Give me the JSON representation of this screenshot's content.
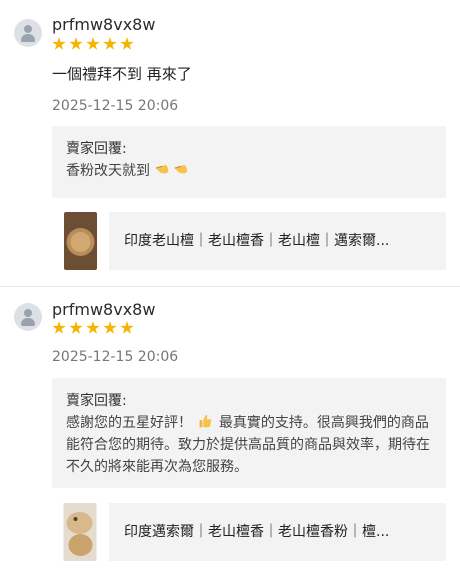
{
  "reviews": [
    {
      "username": "prfmw8vx8w",
      "rating": 5,
      "comment": "一個禮拜不到 再來了",
      "date": "2025-12-15 20:06",
      "reply_title": "賣家回覆:",
      "reply_text": "香粉改天就到",
      "reply_emoji": "pointing-hands-emoji",
      "product_name": "印度老山檀｜老山檀香｜老山檀｜邁索爾..."
    },
    {
      "username": "prfmw8vx8w",
      "rating": 5,
      "comment": "",
      "date": "2025-12-15 20:06",
      "reply_title": "賣家回覆:",
      "reply_text_before": "感謝您的五星好評！",
      "reply_emoji": "thumbs-up-emoji",
      "reply_text_after": " 最真實的支持。很高興我們的商品能符合您的期待。致力於提供高品質的商品與效率，期待在不久的將來能再次為您服務。",
      "product_name": "印度邁索爾｜老山檀香｜老山檀香粉｜檀..."
    }
  ],
  "colors": {
    "star": "#f5b400",
    "reply_bg": "#f3f3f3"
  }
}
